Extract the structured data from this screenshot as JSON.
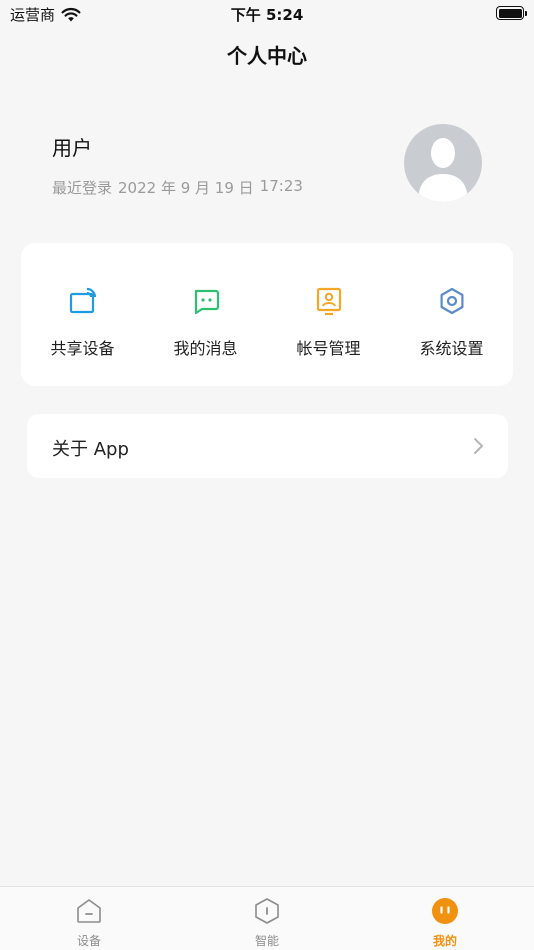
{
  "status_bar": {
    "carrier": "运营商",
    "time": "下午 5:24",
    "icons": [
      "wifi-icon",
      "battery-icon"
    ]
  },
  "header": {
    "title": "个人中心"
  },
  "profile": {
    "username": "用户",
    "last_login_label": "最近登录",
    "last_login_date": "2022 年 9 月 19 日",
    "last_login_time": "17:23",
    "avatar_icon": "default-avatar-icon"
  },
  "actions": [
    {
      "label": "共享设备",
      "icon": "share-device-icon",
      "color": "#1e9be6"
    },
    {
      "label": "我的消息",
      "icon": "message-icon",
      "color": "#2fbf71"
    },
    {
      "label": "帐号管理",
      "icon": "account-icon",
      "color": "#f5a623"
    },
    {
      "label": "系统设置",
      "icon": "settings-icon",
      "color": "#5b8bc9"
    }
  ],
  "about": {
    "label": "关于 App",
    "icon": "chevron-right-icon"
  },
  "tabs": [
    {
      "label": "设备",
      "icon": "device-tab-icon",
      "active": false
    },
    {
      "label": "智能",
      "icon": "smart-tab-icon",
      "active": false
    },
    {
      "label": "我的",
      "icon": "mine-tab-icon",
      "active": true
    }
  ],
  "colors": {
    "background": "#f6f6f6",
    "card": "#ffffff",
    "accent": "#f0920f",
    "muted_text": "#9a9a9a"
  }
}
